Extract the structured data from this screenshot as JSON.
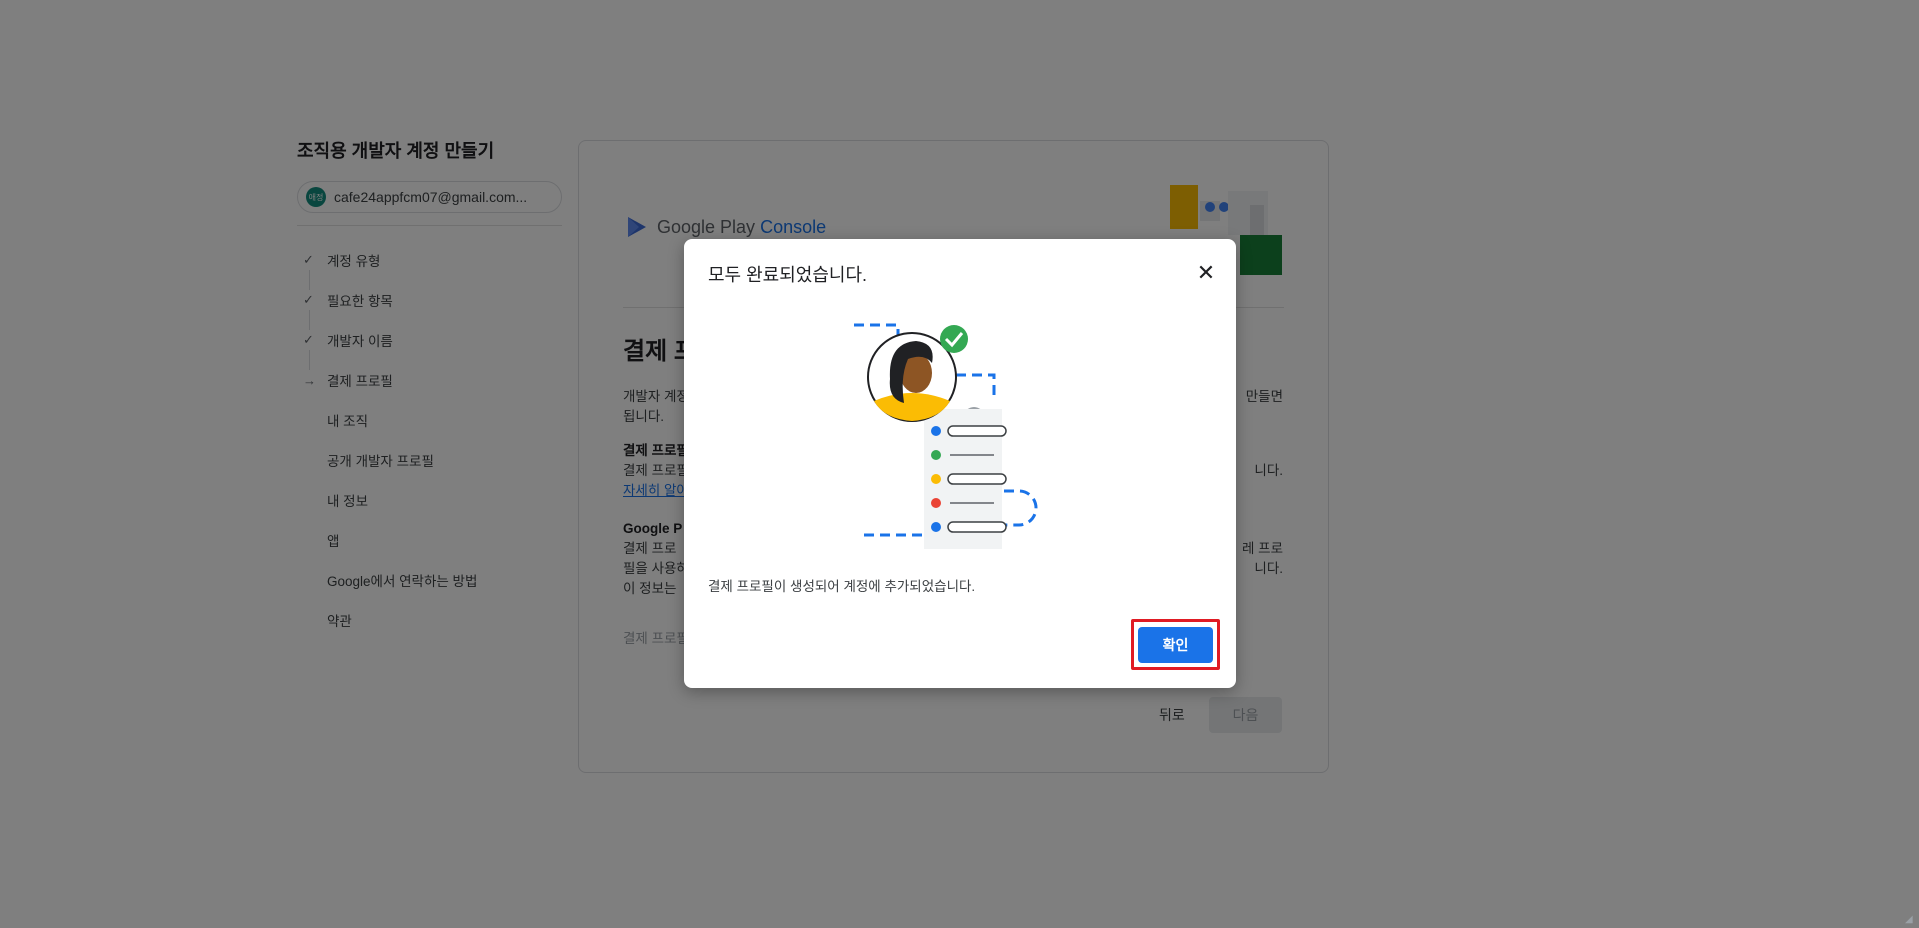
{
  "left": {
    "title": "조직용 개발자 계정 만들기",
    "account": {
      "avatar_text": "애정",
      "email": "cafe24appfcm07@gmail.com..."
    },
    "steps": [
      {
        "icon": "✓",
        "label": "계정 유형"
      },
      {
        "icon": "✓",
        "label": "필요한 항목"
      },
      {
        "icon": "✓",
        "label": "개발자 이름"
      },
      {
        "icon": "→",
        "label": "결제 프로필"
      },
      {
        "icon": "",
        "label": "내 조직"
      },
      {
        "icon": "",
        "label": "공개 개발자 프로필"
      },
      {
        "icon": "",
        "label": "내 정보"
      },
      {
        "icon": "",
        "label": "앱"
      },
      {
        "icon": "",
        "label": "Google에서 연락하는 방법"
      },
      {
        "icon": "",
        "label": "약관"
      }
    ]
  },
  "card": {
    "logo_text": "Google Play",
    "logo_console": "Console",
    "heading": "결제 프",
    "para1_a": "개발자 계정",
    "para1_b": "만들면",
    "para1_c": "됩니다.",
    "para2_bold": "결제 프로필",
    "para2_text": "결제 프로필",
    "para2_tail": "니다.",
    "para2_link": "자세히 알아",
    "para3_bold": "Google P",
    "para3_l1": "결제 프로",
    "para3_l1_tail": "레 프로",
    "para3_l2": "필을 사용하",
    "para3_l2_tail": "니다.",
    "para3_l3": "이 정보는",
    "para4": "결제 프로필",
    "back_label": "뒤로",
    "next_label": "다음"
  },
  "dialog": {
    "title": "모두 완료되었습니다.",
    "close_label": "✕",
    "message": "결제 프로필이 생성되어 계정에 추가되었습니다.",
    "confirm_label": "확인"
  },
  "colors": {
    "accent": "#1a73e8",
    "highlight": "#e01b24",
    "overlay": "rgba(0,0,0,0.5)"
  }
}
